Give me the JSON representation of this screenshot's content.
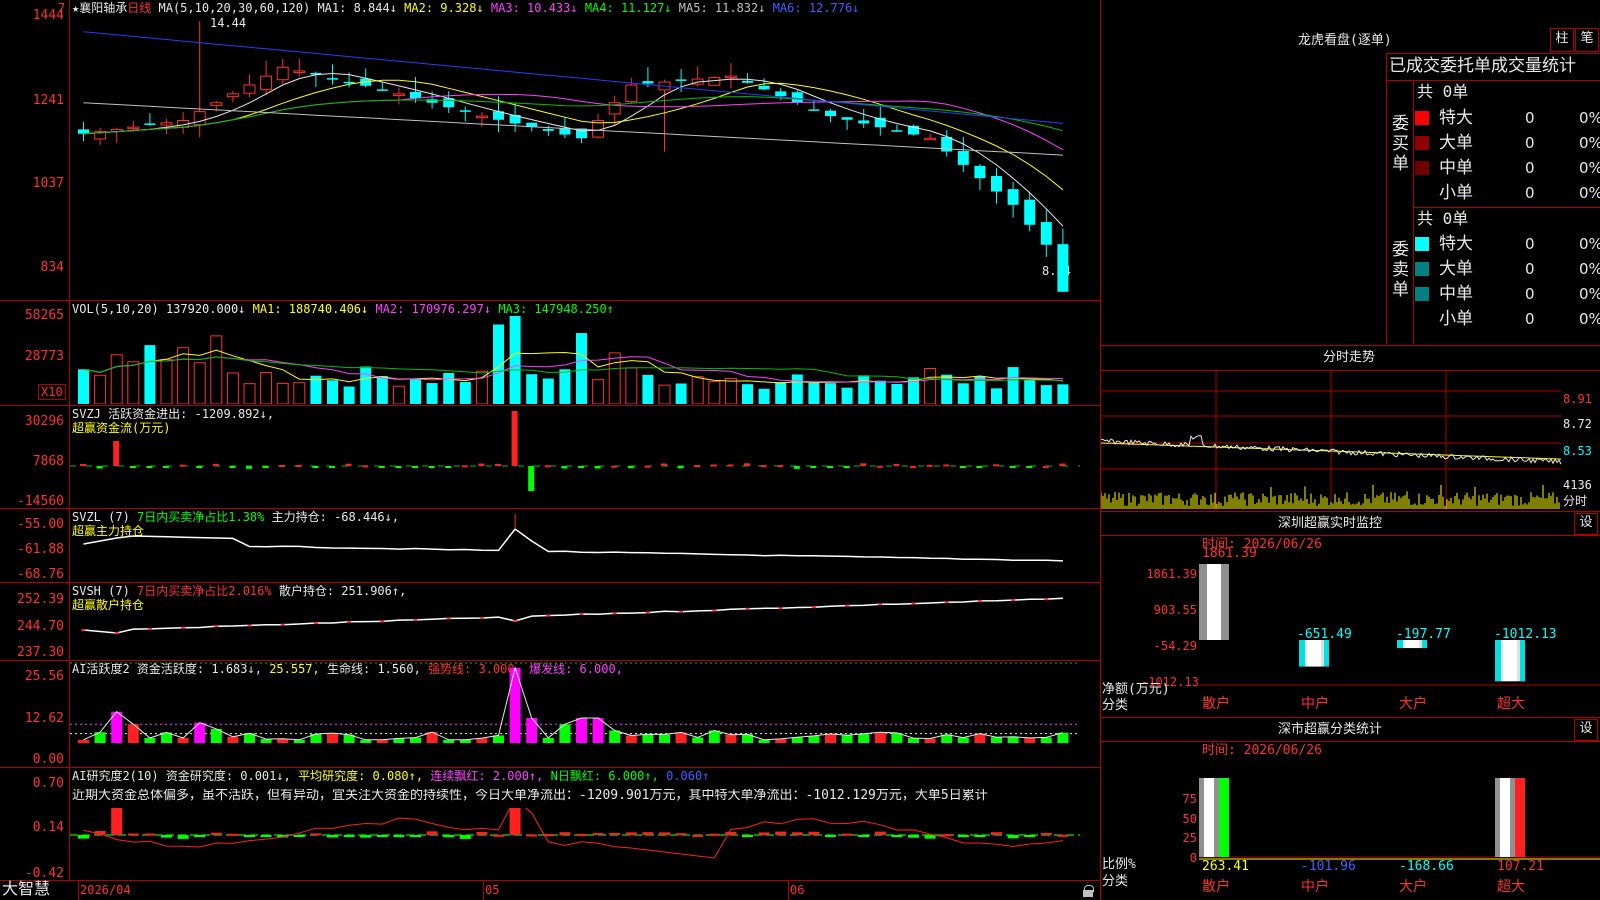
{
  "main_chart": {
    "header": {
      "star": "★",
      "name": "襄阳轴承",
      "period": "日线",
      "ma_params": "MA(5,10,20,30,60,120)",
      "ma1": "MA1: 8.844↓",
      "ma2": "MA2: 9.328↓",
      "ma3": "MA3: 10.433↓",
      "ma4": "MA4: 11.127↓",
      "ma5": "MA5: 11.832↓",
      "ma6": "MA6: 12.776↓"
    },
    "y_labels": [
      "1444",
      "1241",
      "1037",
      "834"
    ],
    "high_label": "14.44",
    "low_label": "8.34",
    "top_marker": "7"
  },
  "volume": {
    "header": {
      "name": "VOL(5,10,20)",
      "value": "137920.000↓",
      "ma1": "MA1: 188740.406↓",
      "ma2": "MA2: 170976.297↓",
      "ma3": "MA3: 147948.250↑"
    },
    "y_labels": [
      "58265",
      "28773"
    ],
    "unit": "X10"
  },
  "svzj": {
    "header": {
      "name": "SVZJ",
      "text": "活跃资金进出: -1209.892↓,"
    },
    "subtitle": "超赢资金流(万元)",
    "y_labels": [
      "30296",
      "7868",
      "-14560"
    ]
  },
  "svzl": {
    "header": {
      "name": "SVZL (7)",
      "text1": "7日内买卖净占比1.38%",
      "text2": "主力持仓: -68.446↓,"
    },
    "subtitle": "超赢主力持仓",
    "y_labels": [
      "-55.00",
      "-61.88",
      "-68.76"
    ]
  },
  "svsh": {
    "header": {
      "name": "SVSH (7)",
      "text1": "7日内买卖净占比2.016%",
      "text2": "散户持仓: 251.906↑,"
    },
    "subtitle": "超赢散户持仓",
    "y_labels": [
      "252.39",
      "244.70",
      "237.30"
    ]
  },
  "ai_active": {
    "header": {
      "name": "AI活跃度2",
      "t1": "资金活跃度: 1.683↓,",
      "t2": "25.557,",
      "t3": "生命线: 1.560,",
      "t4": "强势线: 3.000,",
      "t5": "爆发线: 6.000,"
    },
    "y_labels": [
      "25.56",
      "12.62",
      "0.00"
    ]
  },
  "ai_research": {
    "header": {
      "name": "AI研究度2(10)",
      "t1": "资金研究度: 0.001↓,",
      "t2": "平均研究度: 0.080↑,",
      "t3": "连续飘红: 2.000↑,",
      "t4": "N日飘红: 6.000↑,",
      "t5": "0.060↑"
    },
    "commentary": "近期大资金总体偏多，虽不活跃，但有异动，宜关注大资金的持续性，今日大单净流出：-1209.901万元，其中特大单净流出：-1012.129万元，大单5日累计",
    "y_labels": [
      "0.70",
      "0.14",
      "-0.42"
    ]
  },
  "x_axis": {
    "labels": [
      "2026/04",
      "05",
      "06"
    ]
  },
  "brand": "大智慧",
  "right_panel": {
    "dragon": {
      "title": "龙虎看盘(逐单)",
      "btn_bar": "柱",
      "btn_pen": "笔",
      "subtitle": "已成交委托单成交量统计",
      "buy_total": "共 0单",
      "sell_total": "共 0单",
      "buy_label": [
        "委",
        "买",
        "单"
      ],
      "sell_label": [
        "委",
        "卖",
        "单"
      ],
      "buy_rows": [
        {
          "name": "特大",
          "color": "#ff0000",
          "vol": "0",
          "pct": "0%"
        },
        {
          "name": "大单",
          "color": "#900000",
          "vol": "0",
          "pct": "0%"
        },
        {
          "name": "中单",
          "color": "#700000",
          "vol": "0",
          "pct": "0%"
        },
        {
          "name": "小单",
          "color": "#000000",
          "vol": "0",
          "pct": "0%"
        }
      ],
      "sell_rows": [
        {
          "name": "特大",
          "color": "#00ffff",
          "vol": "0",
          "pct": "0%"
        },
        {
          "name": "大单",
          "color": "#008080",
          "vol": "0",
          "pct": "0%"
        },
        {
          "name": "中单",
          "color": "#008080",
          "vol": "0",
          "pct": "0%"
        },
        {
          "name": "小单",
          "color": "#000000",
          "vol": "0",
          "pct": "0%"
        }
      ]
    },
    "intraday": {
      "title": "分时走势",
      "y_labels": [
        "8.91",
        "8.72",
        "8.53"
      ],
      "vol_label": "4136",
      "vol_unit": "分时"
    },
    "sz_monitor": {
      "title": "深圳超赢实时监控",
      "btn": "设",
      "time": "时间: 2026/06/26",
      "y_labels": [
        "1861.39",
        "903.55",
        "-54.29",
        "-1012.13"
      ],
      "y_title": "净额(万元)",
      "x_title": "分类",
      "bar_values": [
        "1861.39",
        "-651.49",
        "-197.77",
        "-1012.13"
      ],
      "categories": [
        "散户",
        "中户",
        "大户",
        "超大"
      ]
    },
    "sz_stats": {
      "title": "深市超赢分类统计",
      "btn": "设",
      "time": "时间: 2026/06/26",
      "y_labels": [
        "75",
        "50",
        "25",
        "0"
      ],
      "y_title": "比例%",
      "x_title": "分类",
      "bar_values": [
        "263.41",
        "-101.96",
        "-168.66",
        "107.21"
      ],
      "categories": [
        "散户",
        "中户",
        "大户",
        "超大"
      ]
    }
  },
  "colors": {
    "up": "#ff3030",
    "down": "#00ffff",
    "grid": "#b00000"
  }
}
